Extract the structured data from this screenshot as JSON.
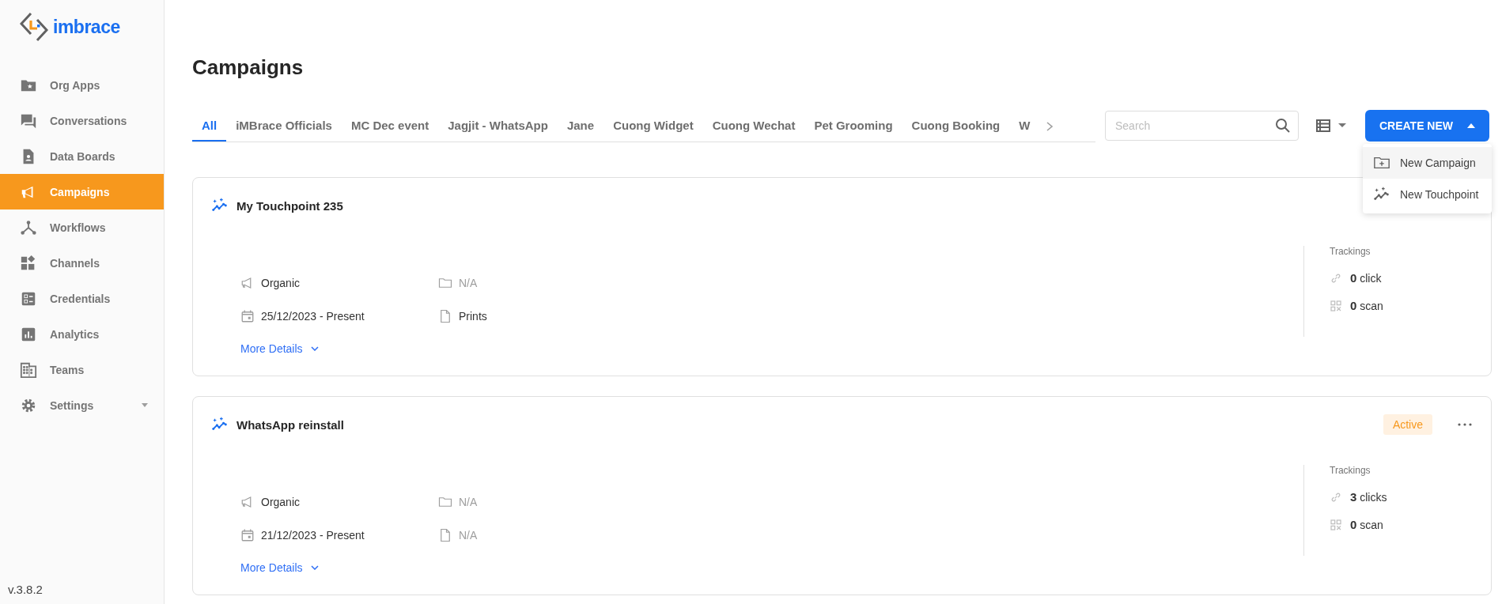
{
  "logo": {
    "text": "imbrace"
  },
  "sidebar": {
    "items": [
      {
        "label": "Org Apps",
        "selected": false
      },
      {
        "label": "Conversations",
        "selected": false
      },
      {
        "label": "Data Boards",
        "selected": false
      },
      {
        "label": "Campaigns",
        "selected": true
      },
      {
        "label": "Workflows",
        "selected": false
      },
      {
        "label": "Channels",
        "selected": false
      },
      {
        "label": "Credentials",
        "selected": false
      },
      {
        "label": "Analytics",
        "selected": false
      },
      {
        "label": "Teams",
        "selected": false
      },
      {
        "label": "Settings",
        "selected": false,
        "expandable": true
      }
    ],
    "version": "v.3.8.2"
  },
  "page": {
    "title": "Campaigns"
  },
  "tabs": [
    {
      "label": "All",
      "selected": true
    },
    {
      "label": "iMBrace Officials",
      "selected": false
    },
    {
      "label": "MC Dec event",
      "selected": false
    },
    {
      "label": "Jagjit - WhatsApp",
      "selected": false
    },
    {
      "label": "Jane",
      "selected": false
    },
    {
      "label": "Cuong Widget",
      "selected": false
    },
    {
      "label": "Cuong Wechat",
      "selected": false
    },
    {
      "label": "Pet Grooming",
      "selected": false
    },
    {
      "label": "Cuong Booking",
      "selected": false
    },
    {
      "label": "W",
      "selected": false
    }
  ],
  "search": {
    "placeholder": "Search"
  },
  "create_button": {
    "label": "CREATE NEW",
    "expanded": true
  },
  "create_menu": [
    {
      "label": "New Campaign",
      "kind": "campaign",
      "highlighted": true
    },
    {
      "label": "New Touchpoint",
      "kind": "touchpoint",
      "highlighted": false
    }
  ],
  "cards": [
    {
      "title": "My Touchpoint 235",
      "meta": [
        {
          "kind": "channel",
          "text": "Organic",
          "empty": false
        },
        {
          "kind": "folder",
          "text": "N/A",
          "empty": true
        },
        {
          "kind": "date",
          "text": "25/12/2023 - Present",
          "empty": false
        },
        {
          "kind": "file",
          "text": "Prints",
          "empty": false
        }
      ],
      "more_details": "More Details",
      "trackings_label": "Trackings",
      "trackings": [
        {
          "kind": "link",
          "count": "0",
          "unit": "click"
        },
        {
          "kind": "qr",
          "count": "0",
          "unit": "scan"
        }
      ]
    },
    {
      "title": "WhatsApp reinstall",
      "status": "Active",
      "meta": [
        {
          "kind": "channel",
          "text": "Organic",
          "empty": false
        },
        {
          "kind": "folder",
          "text": "N/A",
          "empty": true
        },
        {
          "kind": "date",
          "text": "21/12/2023 - Present",
          "empty": false
        },
        {
          "kind": "file",
          "text": "N/A",
          "empty": true
        }
      ],
      "more_details": "More Details",
      "trackings_label": "Trackings",
      "trackings": [
        {
          "kind": "link",
          "count": "3",
          "unit": "clicks"
        },
        {
          "kind": "qr",
          "count": "0",
          "unit": "scan"
        }
      ]
    }
  ]
}
